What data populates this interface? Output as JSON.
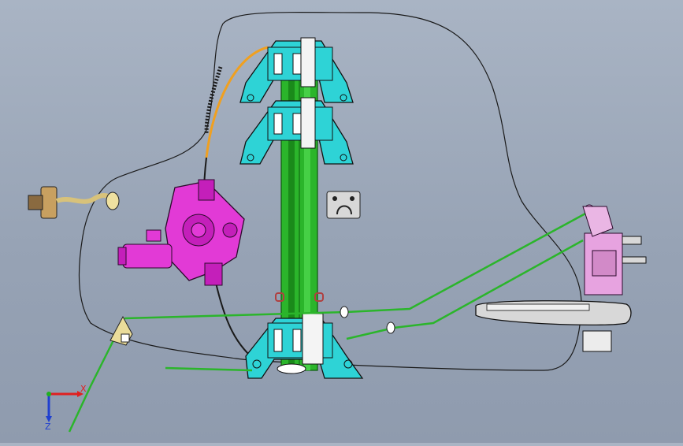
{
  "viewport": {
    "background_top": "#a9b4c4",
    "background_bottom": "#8f9bae"
  },
  "colors": {
    "cyan_part": "#2ed3d6",
    "magenta_motor": "#e23ad6",
    "green_rail": "#2bb52b",
    "orange_cable": "#f0a020",
    "pink_latch": "#e7a3e0",
    "outline": "#1a1a1a"
  },
  "triad": {
    "x_label": "X",
    "z_label": "Z",
    "x_color": "#e02020",
    "y_color": "#20b020",
    "z_color": "#2040d0"
  },
  "parts": [
    "door-outline",
    "window-regulator-rail",
    "regulator-carrier-top",
    "regulator-carrier-middle",
    "regulator-carrier-bottom",
    "window-motor",
    "door-check-link",
    "outside-handle",
    "door-latch",
    "clip-bracket",
    "bellcrank",
    "control-rods"
  ]
}
